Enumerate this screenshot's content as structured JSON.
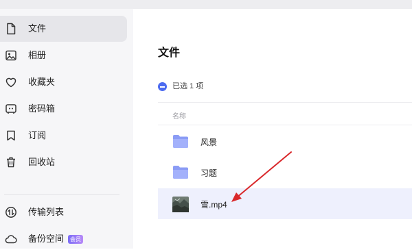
{
  "sidebar": {
    "items": [
      {
        "label": "文件",
        "icon": "file-icon",
        "active": true
      },
      {
        "label": "相册",
        "icon": "photo-icon"
      },
      {
        "label": "收藏夹",
        "icon": "heart-icon"
      },
      {
        "label": "密码箱",
        "icon": "safe-icon"
      },
      {
        "label": "订阅",
        "icon": "bookmark-icon"
      },
      {
        "label": "回收站",
        "icon": "trash-icon"
      },
      {
        "label": "传输列表",
        "icon": "transfer-icon"
      },
      {
        "label": "备份空间",
        "icon": "cloud-icon",
        "badge": "会员"
      }
    ]
  },
  "main": {
    "title": "文件",
    "selection": "已选 1 项",
    "column_name": "名称",
    "rows": [
      {
        "name": "风景",
        "type": "folder"
      },
      {
        "name": "习题",
        "type": "folder"
      },
      {
        "name": "雪.mp4",
        "type": "video",
        "selected": true
      }
    ]
  },
  "colors": {
    "accent": "#4c6bf0",
    "selected_row": "#eef0fd",
    "annotation_arrow": "#d9282b"
  }
}
